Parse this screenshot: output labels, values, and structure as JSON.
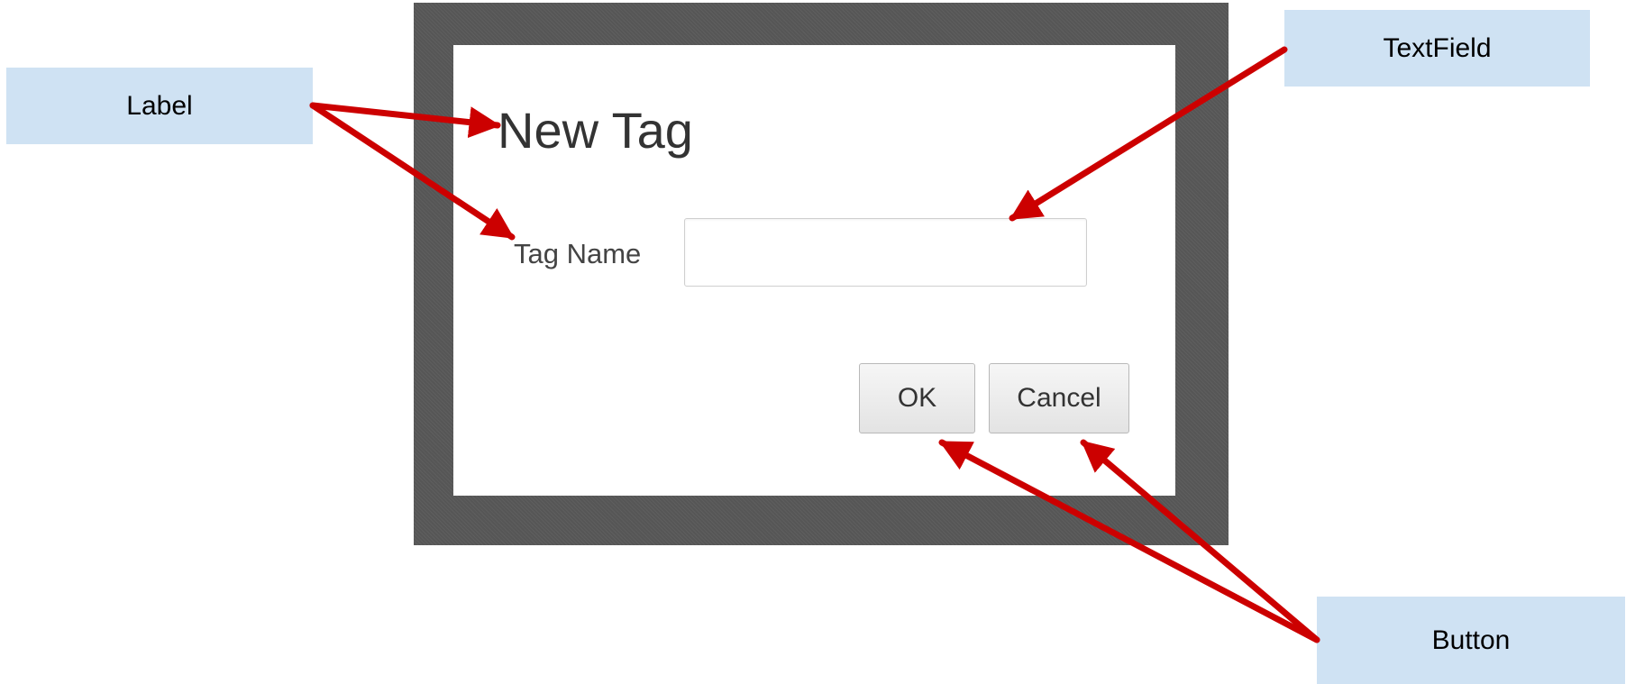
{
  "dialog": {
    "title": "New Tag",
    "field_label": "Tag Name",
    "tag_name_value": "",
    "ok_label": "OK",
    "cancel_label": "Cancel"
  },
  "annotations": {
    "label": "Label",
    "textfield": "TextField",
    "button": "Button"
  },
  "colors": {
    "frame": "#565656",
    "callout_fill": "#cfe2f3",
    "arrow": "#cc0000"
  }
}
